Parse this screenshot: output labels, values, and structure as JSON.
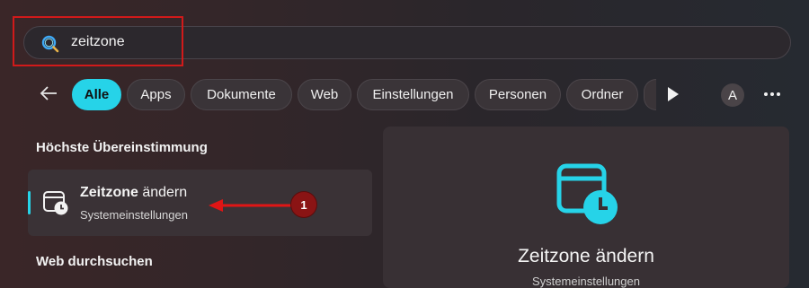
{
  "search": {
    "value": "zeitzone"
  },
  "filters": {
    "items": [
      {
        "label": "Alle",
        "active": true
      },
      {
        "label": "Apps"
      },
      {
        "label": "Dokumente"
      },
      {
        "label": "Web"
      },
      {
        "label": "Einstellungen"
      },
      {
        "label": "Personen"
      },
      {
        "label": "Ordner"
      }
    ]
  },
  "account": {
    "initial": "A"
  },
  "results": {
    "best_match_heading": "Höchste Übereinstimmung",
    "best_match": {
      "title_bold": "Zeitzone",
      "title_rest": " ändern",
      "subtitle": "Systemeinstellungen"
    },
    "web_heading": "Web durchsuchen"
  },
  "annotation": {
    "number": "1"
  },
  "preview": {
    "title": "Zeitzone ändern",
    "subtitle": "Systemeinstellungen"
  },
  "colors": {
    "accent": "#26d3e8",
    "annotation_red": "#d11a1a"
  },
  "icons": [
    "search-icon",
    "back-arrow-icon",
    "play-icon",
    "more-icon",
    "calendar-clock-icon"
  ]
}
